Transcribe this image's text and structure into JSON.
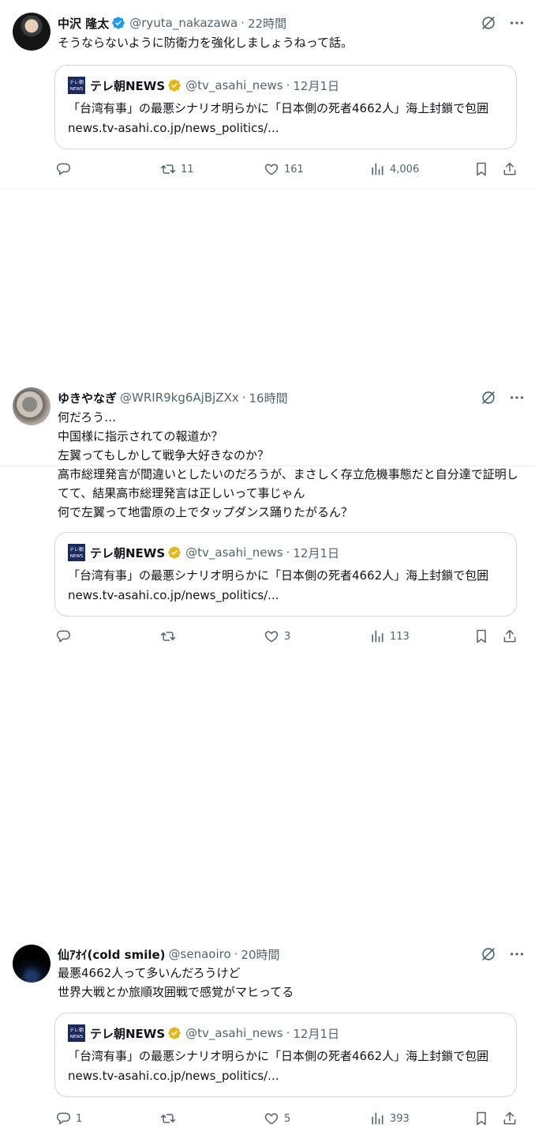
{
  "colors": {
    "accent": "#1d9bf0",
    "gold": "#e2b719",
    "muted": "#536471",
    "text": "#0f1419",
    "border": "#cfd9de"
  },
  "tweets": [
    {
      "name": "中沢 隆太",
      "verified": "blue",
      "handle": "@ryuta_nakazawa",
      "time": "22時間",
      "text": "そうならないように防衛力を強化しましょうねって話。",
      "quote": {
        "logo_text": "テレ朝 NEWS",
        "name": "テレ朝NEWS",
        "handle": "@tv_asahi_news",
        "time": "12月1日",
        "text": "「台湾有事」の最悪シナリオ明らかに「日本側の死者4662人」海上封鎖で包囲 news.tv-asahi.co.jp/news_politics/..."
      },
      "stats": {
        "replies": "",
        "retweets": "11",
        "likes": "161",
        "views": "4,006"
      }
    },
    {
      "name": "ゆきやなぎ",
      "verified": "",
      "handle": "@WRIR9kg6AjBjZXx",
      "time": "16時間",
      "text": "何だろう…\n中国様に指示されての報道か？\n左翼ってもしかして戦争大好きなのか？\n高市総理発言が間違いとしたいのだろうが、まさしく存立危機事態だと自分達で証明してて、結果高市総理発言は正しいって事じゃん\n何で左翼って地雷原の上でタップダンス踊りたがるん？",
      "quote": {
        "logo_text": "テレ朝 NEWS",
        "name": "テレ朝NEWS",
        "handle": "@tv_asahi_news",
        "time": "12月1日",
        "text": "「台湾有事」の最悪シナリオ明らかに「日本側の死者4662人」海上封鎖で包囲 news.tv-asahi.co.jp/news_politics/..."
      },
      "stats": {
        "replies": "",
        "retweets": "",
        "likes": "3",
        "views": "113"
      }
    },
    {
      "name": "仙ｱｵｲ(cold smile)",
      "verified": "",
      "handle": "@senaoiro",
      "time": "20時間",
      "text": "最悪4662人って多いんだろうけど\n世界大戦とか旅順攻囲戦で感覚がマヒってる",
      "quote": {
        "logo_text": "テレ朝 NEWS",
        "name": "テレ朝NEWS",
        "handle": "@tv_asahi_news",
        "time": "12月1日",
        "text": "「台湾有事」の最悪シナリオ明らかに「日本側の死者4662人」海上封鎖で包囲 news.tv-asahi.co.jp/news_politics/..."
      },
      "stats": {
        "replies": "1",
        "retweets": "",
        "likes": "5",
        "views": "393"
      }
    }
  ]
}
